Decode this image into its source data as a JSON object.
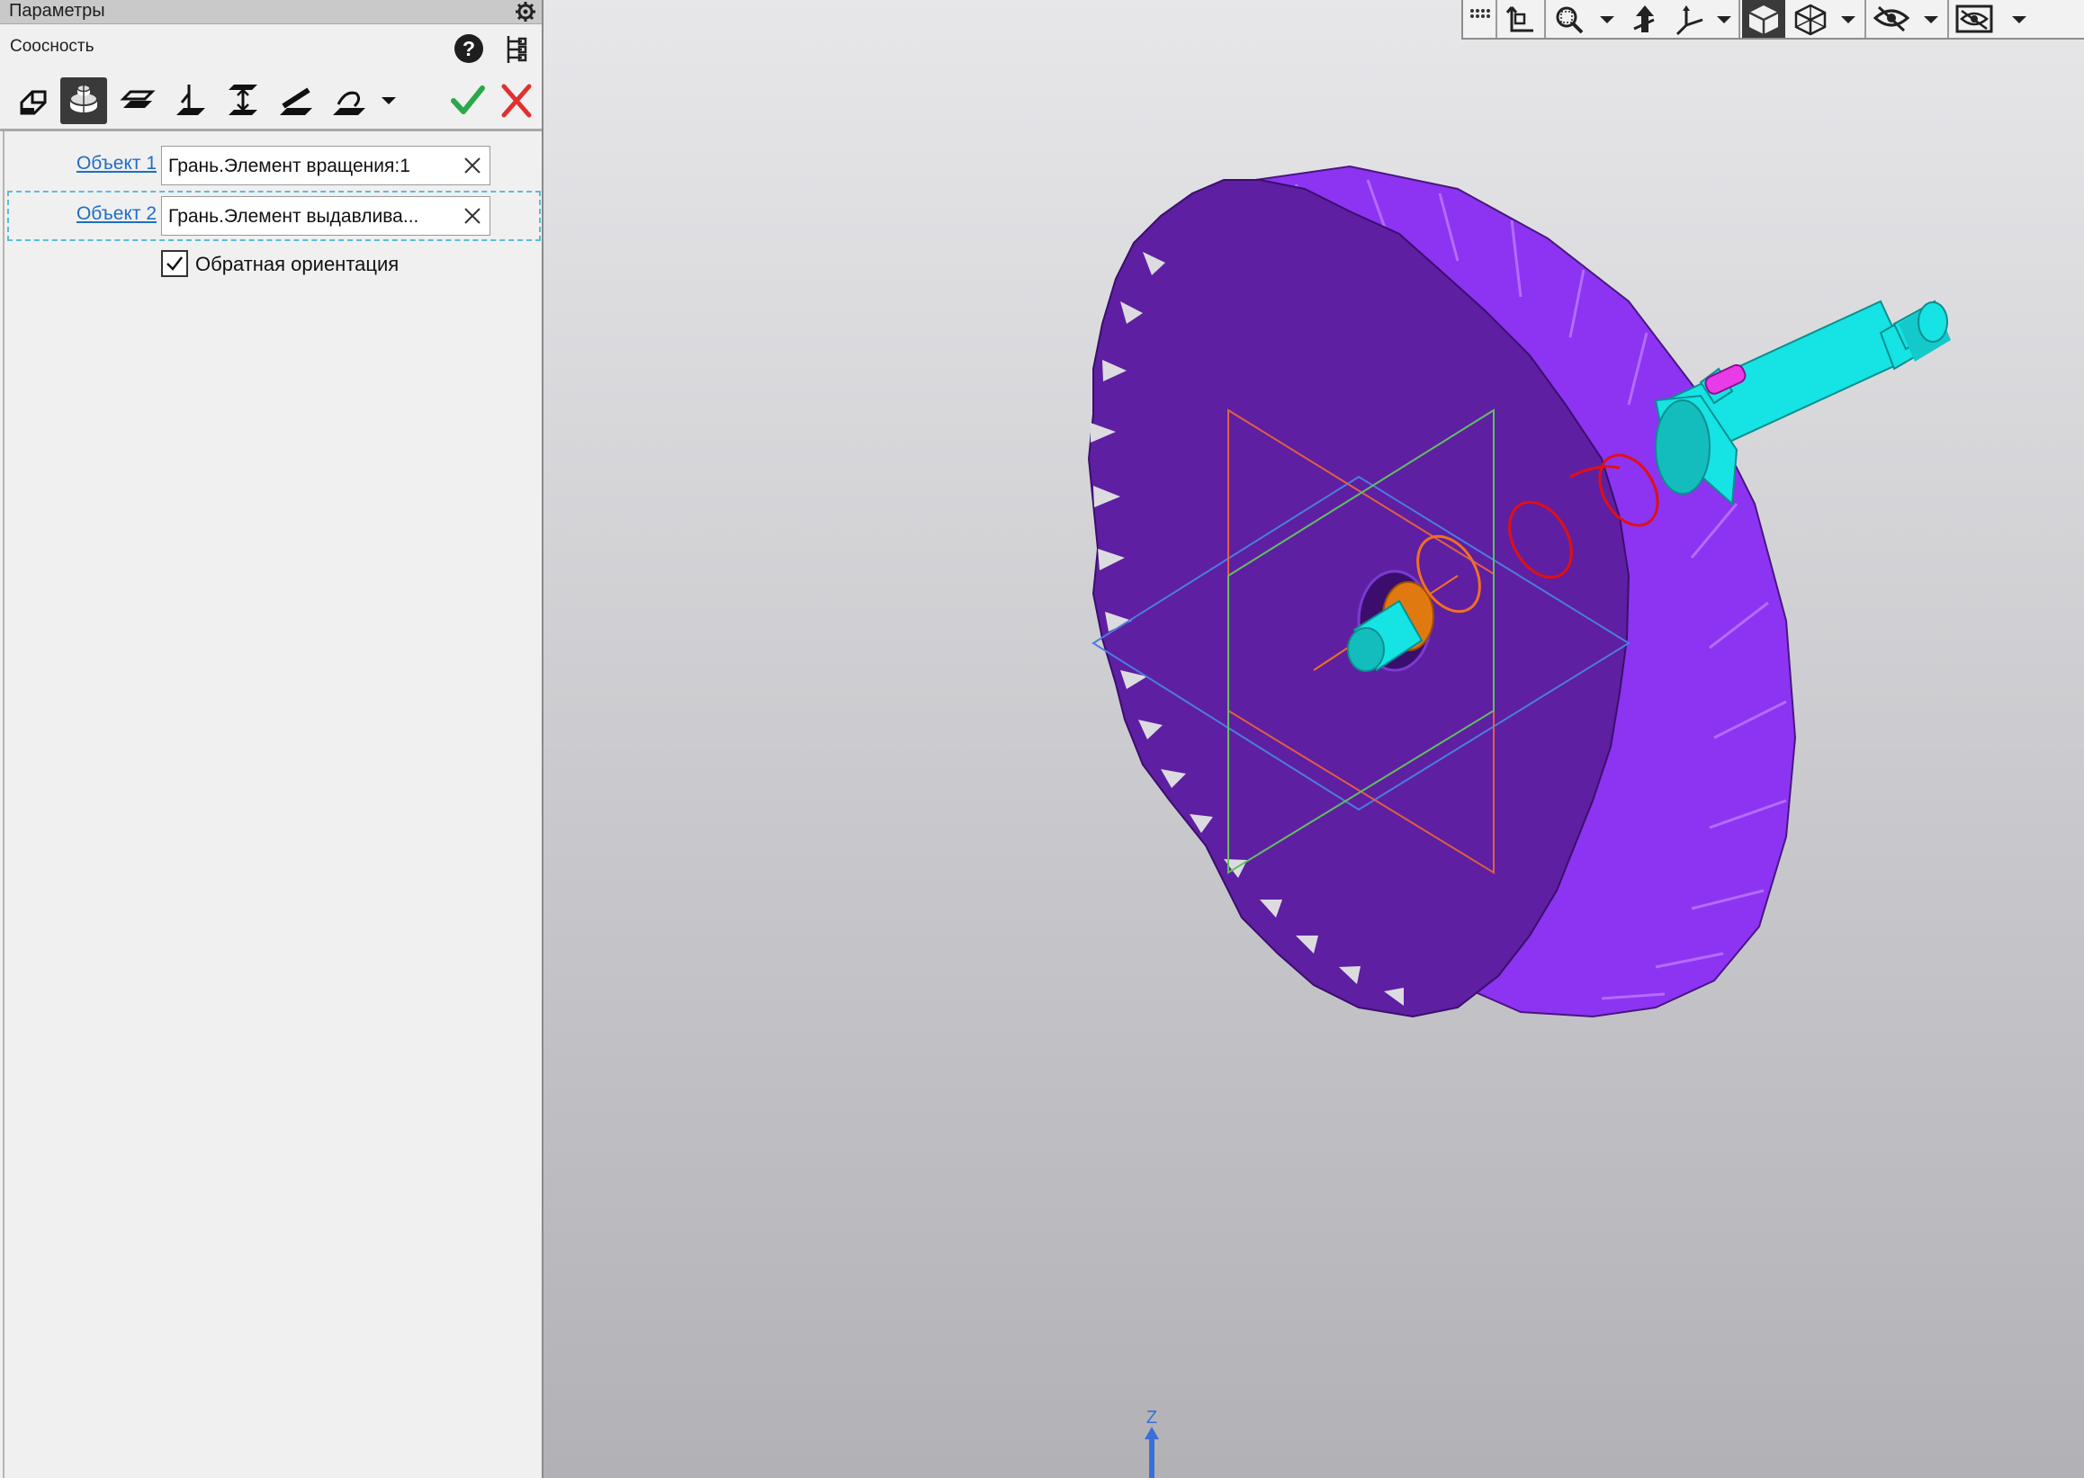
{
  "panel": {
    "title": "Параметры",
    "command": "Соосность",
    "modes": [
      {
        "icon": "parallelism-icon"
      },
      {
        "icon": "coaxial-icon",
        "active": true
      },
      {
        "icon": "coplanar-icon"
      },
      {
        "icon": "perpendicular-icon"
      },
      {
        "icon": "distance-icon"
      },
      {
        "icon": "angle-icon"
      },
      {
        "icon": "tangency-icon"
      }
    ],
    "objects": [
      {
        "label": "Объект 1",
        "value": "Грань.Элемент вращения:1"
      },
      {
        "label": "Объект 2",
        "value": "Грань.Элемент выдавлива..."
      }
    ],
    "reverse_orientation": {
      "label": "Обратная ориентация",
      "checked": true
    }
  },
  "viewport": {
    "axis_label": "Z",
    "toolbar": [
      "grid-icon",
      "local-cs-icon",
      "zoom-icon",
      "orientation-icon",
      "triad-icon",
      "shaded-icon",
      "wireframe-icon",
      "hide-icon",
      "visibility-icon"
    ],
    "model_colors": {
      "gear_face": "#5f1fa2",
      "gear_teeth": "#8c34f2",
      "shaft": "#16e3e3",
      "key": "#e83ce8",
      "selection": "#e01010"
    }
  }
}
